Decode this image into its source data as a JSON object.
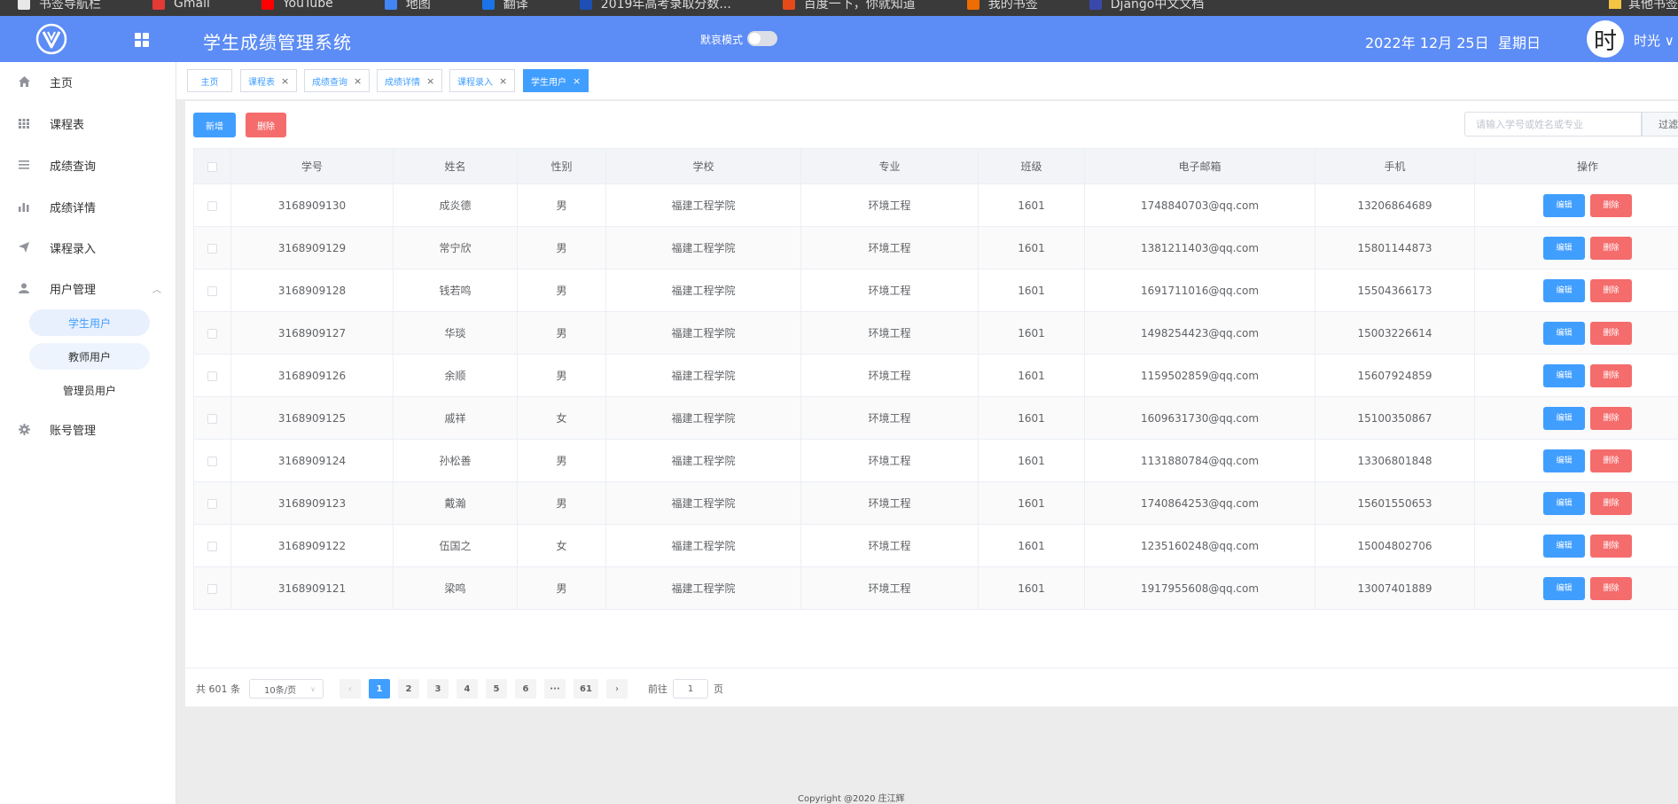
{
  "browser": {
    "bookmarks": [
      {
        "label": "书签导航栏",
        "color": "#e8e8e8"
      },
      {
        "label": "Gmail",
        "color": "#e53935"
      },
      {
        "label": "YouTube",
        "color": "#ff0000"
      },
      {
        "label": "地图",
        "color": "#4285f4"
      },
      {
        "label": "翻译",
        "color": "#1a73e8"
      },
      {
        "label": "2019年高考录取分数...",
        "color": "#1e4fb5"
      },
      {
        "label": "百度一下，你就知道",
        "color": "#e64a19"
      },
      {
        "label": "我的书签",
        "color": "#ef6c00"
      },
      {
        "label": "Django中文文档",
        "color": "#3949ab"
      }
    ],
    "right_label": "其他书签"
  },
  "header": {
    "title": "学生成绩管理系统",
    "mode_label": "默哀模式",
    "date": "2022年 12月 25日",
    "weekday": "星期日",
    "avatar_char": "时",
    "username": "时光"
  },
  "sidebar": {
    "items": [
      {
        "label": "主页",
        "icon": "home-icon"
      },
      {
        "label": "课程表",
        "icon": "grid-list-icon"
      },
      {
        "label": "成绩查询",
        "icon": "list-icon"
      },
      {
        "label": "成绩详情",
        "icon": "bar-chart-icon"
      },
      {
        "label": "课程录入",
        "icon": "send-icon"
      },
      {
        "label": "用户管理",
        "icon": "user-icon"
      },
      {
        "label": "账号管理",
        "icon": "gear-icon"
      }
    ],
    "sub_items": [
      "学生用户",
      "教师用户",
      "管理员用户"
    ]
  },
  "tabs": [
    {
      "label": "主页",
      "closable": false
    },
    {
      "label": "课程表",
      "closable": true
    },
    {
      "label": "成绩查询",
      "closable": true
    },
    {
      "label": "成绩详情",
      "closable": true
    },
    {
      "label": "课程录入",
      "closable": true
    },
    {
      "label": "学生用户",
      "closable": true
    }
  ],
  "toolbar": {
    "add_label": "新增",
    "delete_label": "删除",
    "search_placeholder": "请输入学号或姓名或专业",
    "filter_label": "过滤"
  },
  "table": {
    "columns": [
      "学号",
      "姓名",
      "性别",
      "学校",
      "专业",
      "班级",
      "电子邮箱",
      "手机",
      "操作"
    ],
    "edit_label": "编辑",
    "delete_label": "删除",
    "rows": [
      [
        "3168909130",
        "成炎德",
        "男",
        "福建工程学院",
        "环境工程",
        "1601",
        "1748840703@qq.com",
        "13206864689"
      ],
      [
        "3168909129",
        "常宁欣",
        "男",
        "福建工程学院",
        "环境工程",
        "1601",
        "1381211403@qq.com",
        "15801144873"
      ],
      [
        "3168909128",
        "钱若鸣",
        "男",
        "福建工程学院",
        "环境工程",
        "1601",
        "1691711016@qq.com",
        "15504366173"
      ],
      [
        "3168909127",
        "华琰",
        "男",
        "福建工程学院",
        "环境工程",
        "1601",
        "1498254423@qq.com",
        "15003226614"
      ],
      [
        "3168909126",
        "余顺",
        "男",
        "福建工程学院",
        "环境工程",
        "1601",
        "1159502859@qq.com",
        "15607924859"
      ],
      [
        "3168909125",
        "戚祥",
        "女",
        "福建工程学院",
        "环境工程",
        "1601",
        "1609631730@qq.com",
        "15100350867"
      ],
      [
        "3168909124",
        "孙松善",
        "男",
        "福建工程学院",
        "环境工程",
        "1601",
        "1131880784@qq.com",
        "13306801848"
      ],
      [
        "3168909123",
        "戴瀚",
        "男",
        "福建工程学院",
        "环境工程",
        "1601",
        "1740864253@qq.com",
        "15601550653"
      ],
      [
        "3168909122",
        "伍国之",
        "女",
        "福建工程学院",
        "环境工程",
        "1601",
        "1235160248@qq.com",
        "15004802706"
      ],
      [
        "3168909121",
        "梁鸣",
        "男",
        "福建工程学院",
        "环境工程",
        "1601",
        "1917955608@qq.com",
        "13007401889"
      ]
    ]
  },
  "pagination": {
    "total_label": "共 601 条",
    "page_size": "10条/页",
    "pages": [
      "1",
      "2",
      "3",
      "4",
      "5",
      "6",
      "···",
      "61"
    ],
    "current": "1",
    "goto_prefix": "前往",
    "goto_value": "1",
    "goto_suffix": "页"
  },
  "footer": {
    "text": "Copyright @2020 庄江辉"
  },
  "colors": {
    "header": "#5c8cf5",
    "primary": "#409eff",
    "danger": "#f56c6c"
  }
}
